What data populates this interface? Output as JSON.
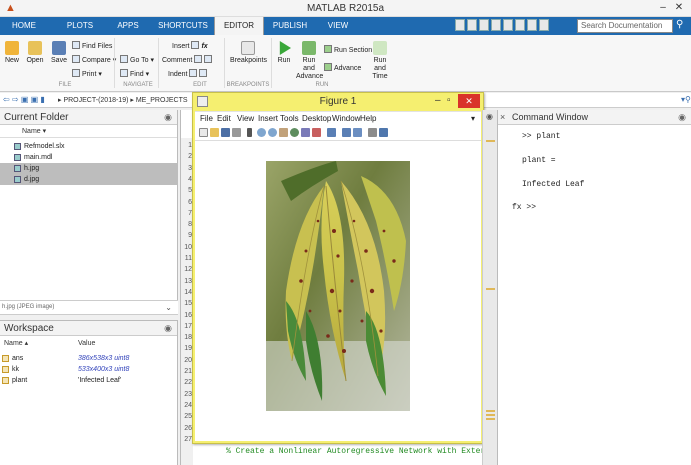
{
  "window": {
    "title": "MATLAB R2015a"
  },
  "tabs": [
    {
      "label": "HOME",
      "active": false
    },
    {
      "label": "PLOTS",
      "active": false
    },
    {
      "label": "APPS",
      "active": false
    },
    {
      "label": "SHORTCUTS",
      "active": false
    },
    {
      "label": "EDITOR",
      "active": true
    },
    {
      "label": "PUBLISH",
      "active": false
    },
    {
      "label": "VIEW",
      "active": false
    }
  ],
  "search": {
    "placeholder": "Search Documentation"
  },
  "ribbon": {
    "new": "New",
    "open": "Open",
    "save": "Save",
    "find_files": "Find Files",
    "compare": "Compare",
    "print": "Print",
    "go_to": "Go To",
    "find": "Find",
    "insert": "Insert",
    "comment": "Comment",
    "indent": "Indent",
    "fx": "fx",
    "breakpoints": "Breakpoints",
    "run": "Run",
    "run_advance": "Run and Advance",
    "run_section": "Run Section",
    "advance": "Advance",
    "run_time": "Run and Time",
    "groups": {
      "file": "FILE",
      "navigate": "NAVIGATE",
      "edit": "EDIT",
      "breakpoints": "BREAKPOINTS",
      "run": "RUN"
    }
  },
  "address": {
    "path": "▸ PROJECT-(2018-19) ▸ ME_PROJECTS"
  },
  "current_folder": {
    "title": "Current Folder",
    "column": "Name ▾",
    "files": [
      {
        "name": "Refmodel.slx",
        "selected": false
      },
      {
        "name": "main.mdl",
        "selected": false
      },
      {
        "name": "h.jpg",
        "selected": true
      },
      {
        "name": "d.jpg",
        "selected": true
      }
    ],
    "detail": "h.jpg (JPEG image)"
  },
  "workspace": {
    "title": "Workspace",
    "col_name": "Name ▴",
    "col_value": "Value",
    "vars": [
      {
        "name": "ans",
        "value": "386x538x3 uint8",
        "kind": "num"
      },
      {
        "name": "kk",
        "value": "533x400x3 uint8",
        "kind": "num"
      },
      {
        "name": "plant",
        "value": "'Infected Leaf'",
        "kind": "str"
      }
    ]
  },
  "editor": {
    "line_numbers": [
      "1",
      "2",
      "3",
      "4",
      "5",
      "6",
      "7",
      "8",
      "9",
      "10",
      "11",
      "12",
      "13",
      "14",
      "15",
      "16",
      "17",
      "18",
      "19",
      "20",
      "21",
      "22",
      "23",
      "24",
      "25",
      "26",
      "27"
    ],
    "visible_line": "% Create a Nonlinear Autoregressive Network with External Input"
  },
  "figure": {
    "title": "Figure 1",
    "menu": [
      "File",
      "Edit",
      "View",
      "Insert",
      "Tools",
      "Desktop",
      "Window",
      "Help"
    ]
  },
  "command_window": {
    "title": "Command Window",
    "lines": [
      ">> plant",
      "plant =",
      "Infected Leaf"
    ],
    "prompt": "fx >>"
  },
  "colors": {
    "accent": "#1f6ab0",
    "figure_frame": "#f5ef70",
    "close_red": "#d9332a"
  }
}
